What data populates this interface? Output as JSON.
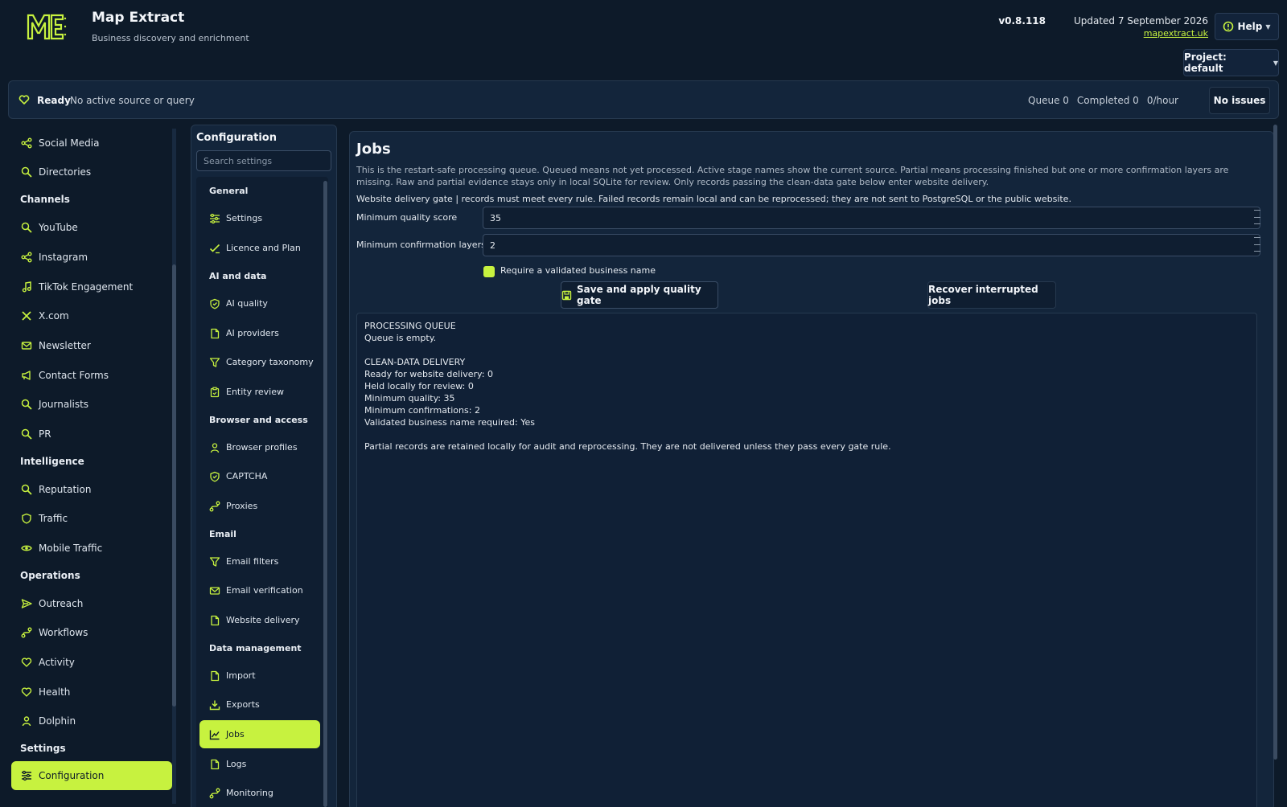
{
  "app": {
    "title": "Map Extract",
    "subtitle": "Business discovery and enrichment",
    "version": "v0.8.118",
    "updated": "Updated 7 September 2026",
    "site": "mapextract.uk",
    "help_label": "Help",
    "project_label": "Project: default",
    "accent_color": "#c7f23f",
    "background_color": "#0d1a29"
  },
  "status": {
    "state": "Ready",
    "text": "No active source or query",
    "queue": "Queue 0",
    "completed": "Completed 0",
    "rate": "0/hour",
    "issues_label": "No issues"
  },
  "nav": {
    "social_media": "Social Media",
    "directories": "Directories",
    "channels_heading": "Channels",
    "youtube": "YouTube",
    "instagram": "Instagram",
    "tiktok": "TikTok Engagement",
    "xcom": "X.com",
    "newsletter": "Newsletter",
    "contact_forms": "Contact Forms",
    "journalists": "Journalists",
    "pr": "PR",
    "intelligence_heading": "Intelligence",
    "reputation": "Reputation",
    "traffic": "Traffic",
    "mobile_traffic": "Mobile Traffic",
    "operations_heading": "Operations",
    "outreach": "Outreach",
    "workflows": "Workflows",
    "activity": "Activity",
    "health": "Health",
    "dolphin": "Dolphin",
    "settings_heading": "Settings",
    "configuration": "Configuration"
  },
  "config": {
    "title": "Configuration",
    "search_placeholder": "Search settings",
    "general_heading": "General",
    "settings": "Settings",
    "licence": "Licence and Plan",
    "ai_heading": "AI and data",
    "ai_quality": "AI quality",
    "ai_providers": "AI providers",
    "category_taxonomy": "Category taxonomy",
    "entity_review": "Entity review",
    "browser_heading": "Browser and access",
    "browser_profiles": "Browser profiles",
    "captcha": "CAPTCHA",
    "proxies": "Proxies",
    "email_heading": "Email",
    "email_filters": "Email filters",
    "email_verification": "Email verification",
    "website_delivery": "Website delivery",
    "data_heading": "Data management",
    "import": "Import",
    "exports": "Exports",
    "jobs": "Jobs",
    "logs": "Logs",
    "monitoring": "Monitoring"
  },
  "jobs": {
    "title": "Jobs",
    "description": "This is the restart-safe processing queue. Queued means not yet processed. Active stage names show the current source. Partial means processing finished but one or more confirmation layers are missing. Raw and partial evidence stays only in local SQLite for review. Only records passing the clean-data gate below enter website delivery.",
    "gate_description": "Website delivery gate | records must meet every rule. Failed records remain local and can be reprocessed; they are not sent to PostgreSQL or the public website.",
    "min_quality_label": "Minimum quality score",
    "min_quality_value": "35",
    "min_confirm_label": "Minimum confirmation layers",
    "min_confirm_value": "2",
    "require_name_label": "Require a validated business name",
    "require_name_checked": true,
    "save_label": "Save and apply quality gate",
    "recover_label": "Recover interrupted jobs",
    "output": {
      "queue_heading": "PROCESSING QUEUE",
      "queue_status": "Queue is empty.",
      "delivery_heading": "CLEAN-DATA DELIVERY",
      "ready": "Ready for website delivery: 0",
      "held": "Held locally for review: 0",
      "min_quality": "Minimum quality: 35",
      "min_confirmations": "Minimum confirmations: 2",
      "validated_required": "Validated business name required: Yes",
      "partial_note": "Partial records are retained locally for audit and reprocessing. They are not delivered unless they pass every gate rule."
    }
  }
}
